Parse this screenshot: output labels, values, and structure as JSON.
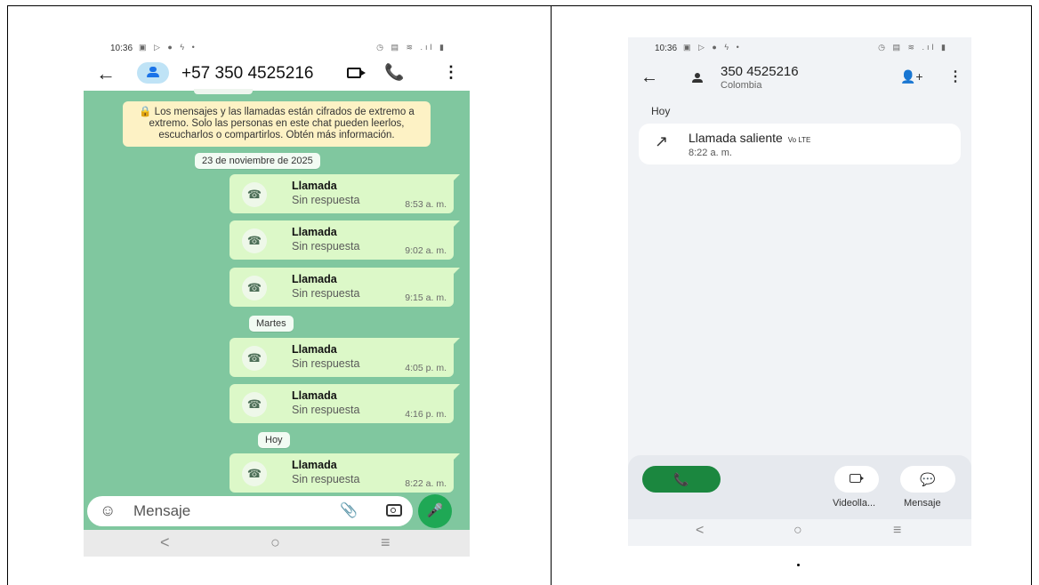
{
  "left_phone": {
    "status": {
      "time": "10:36"
    },
    "header": {
      "contact": "+57 350 4525216"
    },
    "encryption_notice": "🔒 Los mensajes y las llamadas están cifrados de extremo a extremo. Solo las personas en este chat pueden leerlos, escucharlos o compartirlos. Obtén más información.",
    "date_labels": [
      "23 de noviembre de 2025",
      "Martes",
      "Hoy"
    ],
    "calls": [
      {
        "title": "Llamada",
        "status": "Sin respuesta",
        "time": "8:53 a. m."
      },
      {
        "title": "Llamada",
        "status": "Sin respuesta",
        "time": "9:02 a. m."
      },
      {
        "title": "Llamada",
        "status": "Sin respuesta",
        "time": "9:15 a. m."
      },
      {
        "title": "Llamada",
        "status": "Sin respuesta",
        "time": "4:05 p. m."
      },
      {
        "title": "Llamada",
        "status": "Sin respuesta",
        "time": "4:16 p. m."
      },
      {
        "title": "Llamada",
        "status": "Sin respuesta",
        "time": "8:22 a. m."
      }
    ],
    "input": {
      "placeholder": "Mensaje"
    },
    "icons": {
      "back": "←",
      "call": "📞",
      "menu": "⋮",
      "missed_call": "☎",
      "emoji": "☺",
      "clip": "📎",
      "mic": "🎤",
      "nav_back": "<",
      "nav_home": "○",
      "nav_recents": "≡"
    }
  },
  "right_phone": {
    "status": {
      "time": "10:36"
    },
    "header": {
      "number": "350 4525216",
      "country": "Colombia"
    },
    "day_label": "Hoy",
    "call": {
      "title": "Llamada saliente",
      "volte": "Vo LTE",
      "time": "8:22 a. m."
    },
    "actions": {
      "video_label": "Videolla...",
      "message_label": "Mensaje"
    },
    "icons": {
      "back": "←",
      "add_contact": "👤+",
      "menu": "⋮",
      "outgoing": "↗",
      "call": "📞",
      "message": "💬",
      "nav_back": "<",
      "nav_home": "○",
      "nav_recents": "≡"
    }
  },
  "caption_dot": "."
}
